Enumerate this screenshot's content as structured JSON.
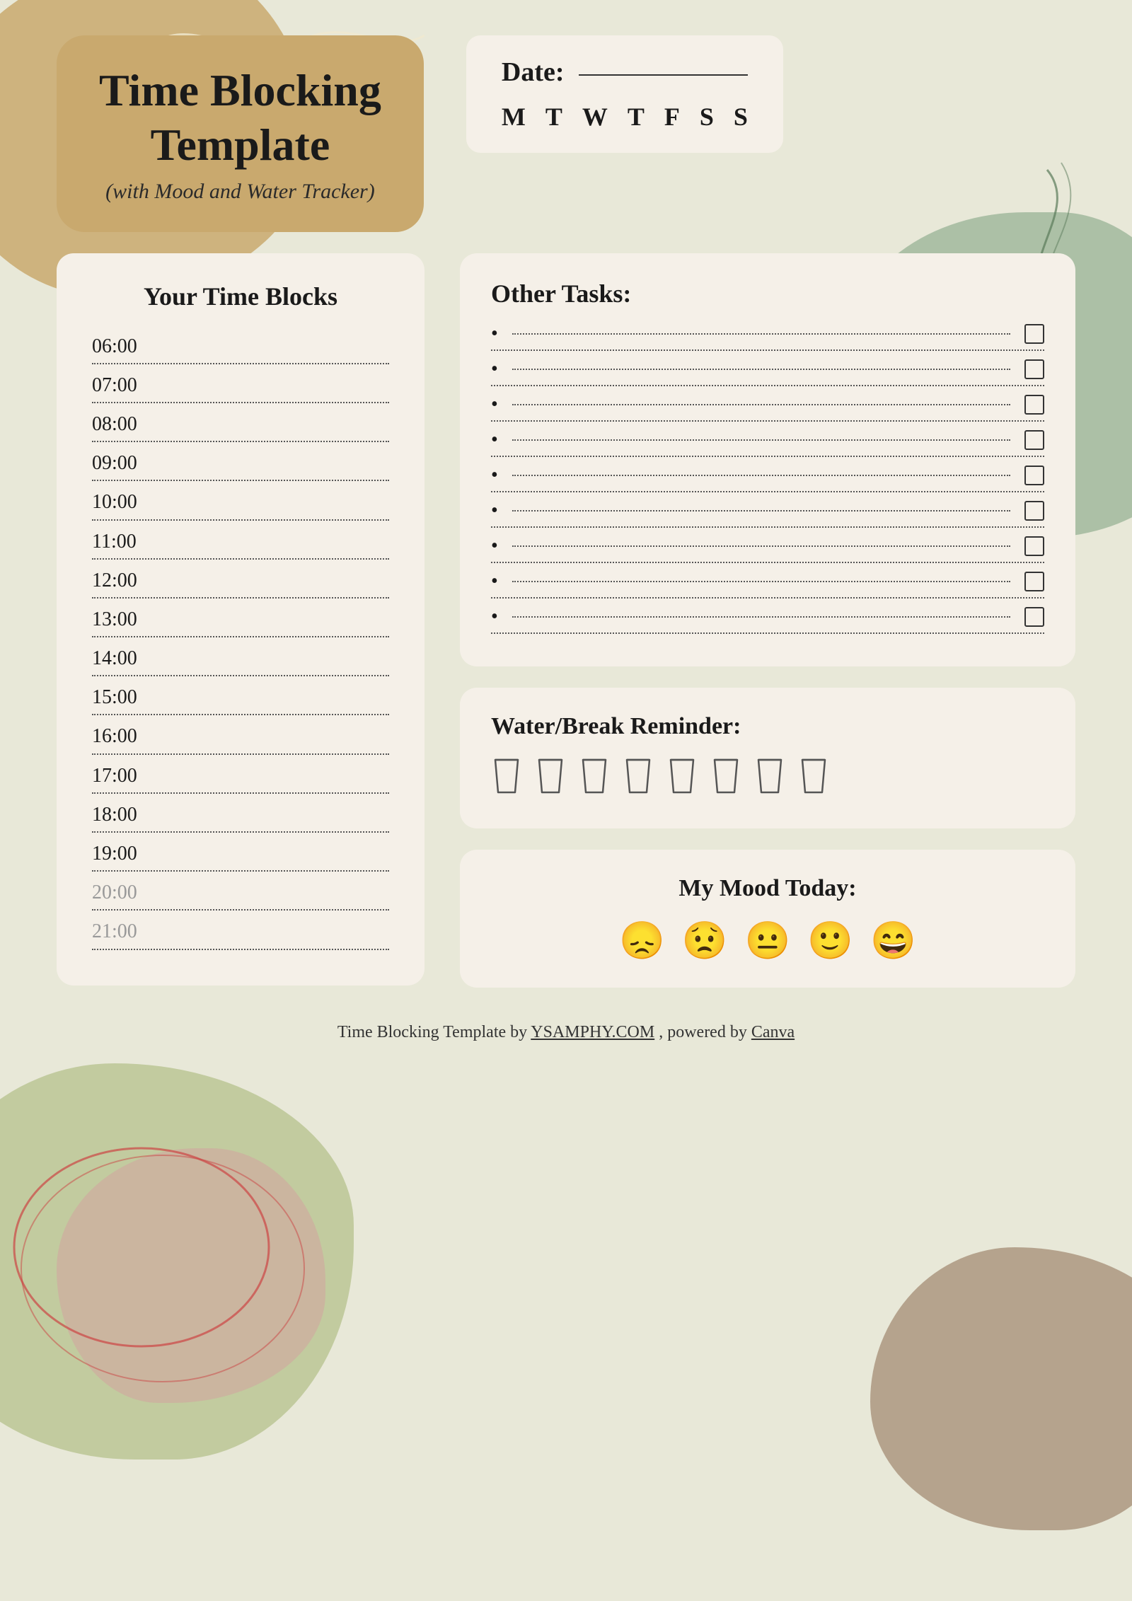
{
  "page": {
    "background_color": "#e8e8d8"
  },
  "header": {
    "title_line1": "Time Blocking",
    "title_line2": "Template",
    "subtitle": "(with Mood and Water Tracker)",
    "date_label": "Date:",
    "days": [
      "M",
      "T",
      "W",
      "T",
      "F",
      "S",
      "S"
    ]
  },
  "time_blocks": {
    "panel_title": "Your Time Blocks",
    "times": [
      {
        "label": "06:00",
        "faded": false
      },
      {
        "label": "07:00",
        "faded": false
      },
      {
        "label": "08:00",
        "faded": false
      },
      {
        "label": "09:00",
        "faded": false
      },
      {
        "label": "10:00",
        "faded": false
      },
      {
        "label": "11:00",
        "faded": false
      },
      {
        "label": "12:00",
        "faded": false
      },
      {
        "label": "13:00",
        "faded": false
      },
      {
        "label": "14:00",
        "faded": false
      },
      {
        "label": "15:00",
        "faded": false
      },
      {
        "label": "16:00",
        "faded": false
      },
      {
        "label": "17:00",
        "faded": false
      },
      {
        "label": "18:00",
        "faded": false
      },
      {
        "label": "19:00",
        "faded": false
      },
      {
        "label": "20:00",
        "faded": true
      },
      {
        "label": "21:00",
        "faded": true
      }
    ]
  },
  "other_tasks": {
    "title": "Other Tasks:",
    "count": 9
  },
  "water_reminder": {
    "title": "Water/Break Reminder:",
    "glass_count": 8,
    "glass_icon": "🥛"
  },
  "mood": {
    "title": "My Mood Today:",
    "faces": [
      "😞",
      "😟",
      "😐",
      "🙂",
      "😄"
    ]
  },
  "footer": {
    "text_before": "Time Blocking Template by ",
    "link1_text": "YSAMPHY.COM",
    "text_middle": " , powered by ",
    "link2_text": "Canva"
  }
}
